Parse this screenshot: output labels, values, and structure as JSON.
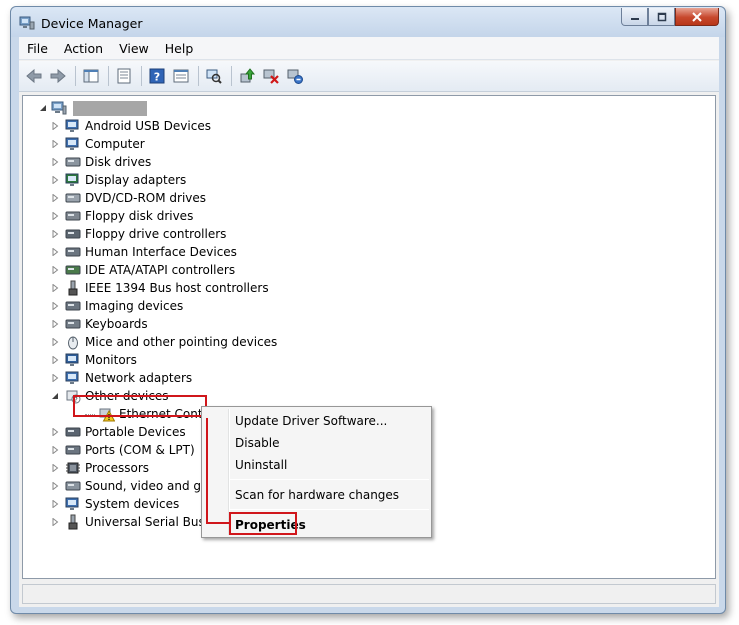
{
  "window": {
    "title": "Device Manager"
  },
  "menu": {
    "items": [
      "File",
      "Action",
      "View",
      "Help"
    ]
  },
  "toolbar": {
    "buttons": [
      "back-icon",
      "forward-icon",
      "show-hide-console-tree-icon",
      "properties-icon",
      "help-icon",
      "details-view-icon",
      "scan-hardware-icon",
      "update-driver-icon",
      "disable-device-icon",
      "uninstall-device-icon"
    ]
  },
  "tree": {
    "root": {
      "label": "",
      "redacted": true,
      "icon": "computer-icon"
    },
    "items": [
      {
        "label": "Android USB Devices",
        "icon": "usb-device-icon",
        "expanded": false
      },
      {
        "label": "Computer",
        "icon": "computer-icon",
        "expanded": false
      },
      {
        "label": "Disk drives",
        "icon": "disk-drive-icon",
        "expanded": false
      },
      {
        "label": "Display adapters",
        "icon": "display-adapter-icon",
        "expanded": false
      },
      {
        "label": "DVD/CD-ROM drives",
        "icon": "dvd-drive-icon",
        "expanded": false
      },
      {
        "label": "Floppy disk drives",
        "icon": "floppy-disk-icon",
        "expanded": false
      },
      {
        "label": "Floppy drive controllers",
        "icon": "floppy-controller-icon",
        "expanded": false
      },
      {
        "label": "Human Interface Devices",
        "icon": "hid-icon",
        "expanded": false
      },
      {
        "label": "IDE ATA/ATAPI controllers",
        "icon": "ide-controller-icon",
        "expanded": false
      },
      {
        "label": "IEEE 1394 Bus host controllers",
        "icon": "ieee1394-icon",
        "expanded": false
      },
      {
        "label": "Imaging devices",
        "icon": "imaging-device-icon",
        "expanded": false
      },
      {
        "label": "Keyboards",
        "icon": "keyboard-icon",
        "expanded": false
      },
      {
        "label": "Mice and other pointing devices",
        "icon": "mouse-icon",
        "expanded": false
      },
      {
        "label": "Monitors",
        "icon": "monitor-icon",
        "expanded": false
      },
      {
        "label": "Network adapters",
        "icon": "network-adapter-icon",
        "expanded": false
      },
      {
        "label": "Other devices",
        "icon": "unknown-device-icon",
        "expanded": true
      },
      {
        "label": "Ethernet Controller",
        "icon": "warning-device-icon",
        "child": true,
        "highlighted": true
      },
      {
        "label": "Portable Devices",
        "icon": "portable-device-icon",
        "expanded": false
      },
      {
        "label": "Ports (COM & LPT)",
        "icon": "port-icon",
        "expanded": false
      },
      {
        "label": "Processors",
        "icon": "processor-icon",
        "expanded": false
      },
      {
        "label": "Sound, video and gam",
        "icon": "sound-icon",
        "expanded": false
      },
      {
        "label": "System devices",
        "icon": "system-device-icon",
        "expanded": false
      },
      {
        "label": "Universal Serial Bus co",
        "icon": "usb-controller-icon",
        "expanded": false
      }
    ]
  },
  "context_menu": {
    "items": [
      {
        "label": "Update Driver Software...",
        "bold": false
      },
      {
        "label": "Disable",
        "bold": false
      },
      {
        "label": "Uninstall",
        "bold": false
      },
      {
        "label": "Scan for hardware changes",
        "bold": false
      },
      {
        "label": "Properties",
        "bold": true,
        "highlighted": true
      }
    ]
  },
  "colors": {
    "highlight": "#d0161b",
    "window_frame": "#c9d8ea",
    "close_button": "#c7482d"
  }
}
